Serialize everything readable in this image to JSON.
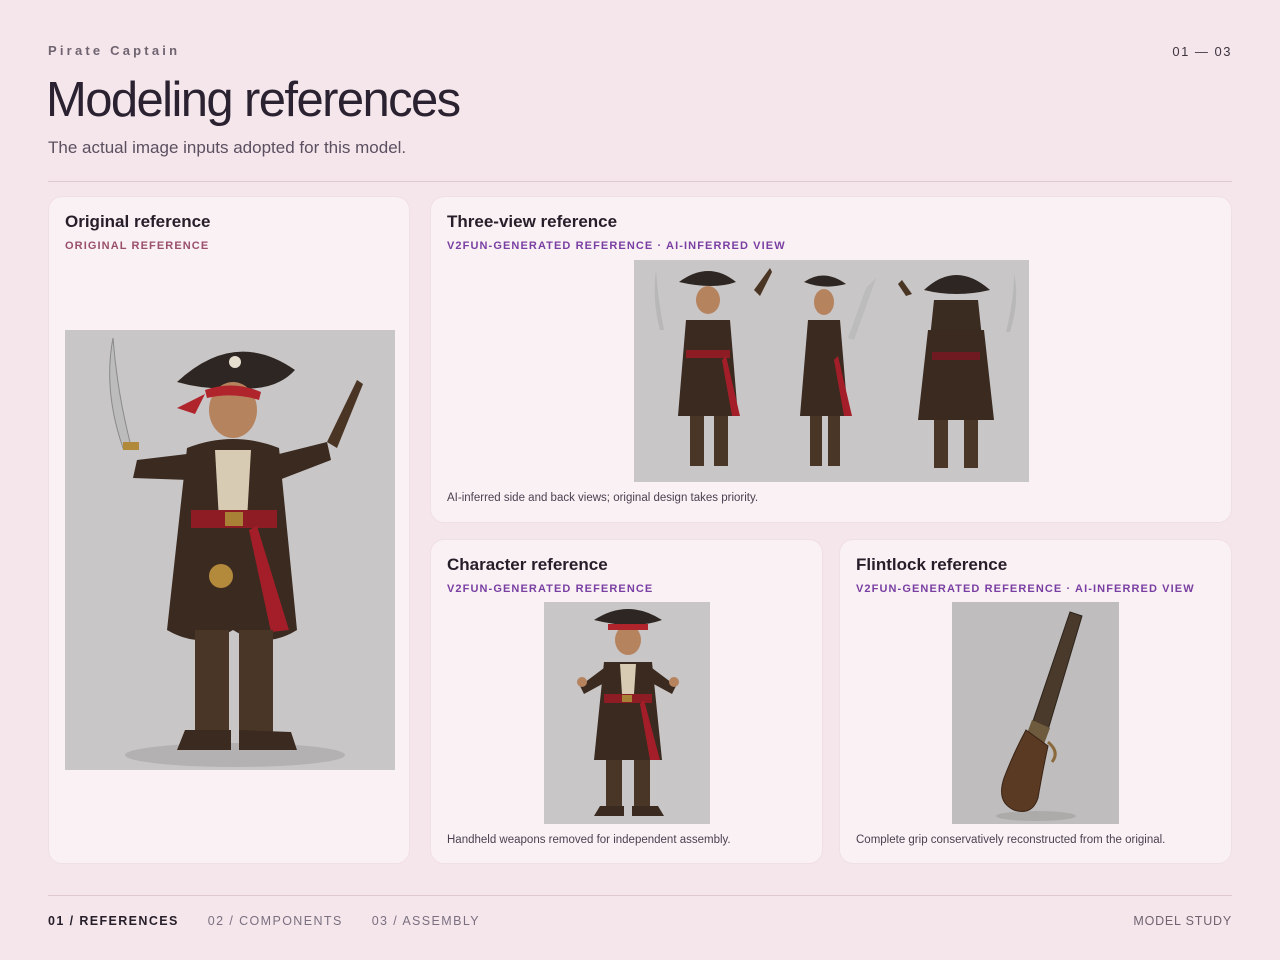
{
  "header": {
    "eyebrow": "Pirate Captain",
    "pager": "01 — 03",
    "title": "Modeling references",
    "subtitle": "The actual image inputs adopted for this model."
  },
  "cards": {
    "original": {
      "title": "Original reference",
      "tag": "ORIGINAL REFERENCE"
    },
    "three_view": {
      "title": "Three-view reference",
      "tag": "V2FUN-GENERATED REFERENCE · AI-INFERRED VIEW",
      "note": "AI-inferred side and back views; original design takes priority."
    },
    "character": {
      "title": "Character reference",
      "tag": "V2FUN-GENERATED REFERENCE",
      "note": "Handheld weapons removed for independent assembly."
    },
    "flintlock": {
      "title": "Flintlock reference",
      "tag": "V2FUN-GENERATED REFERENCE · AI-INFERRED VIEW",
      "note": "Complete grip conservatively reconstructed from the original."
    }
  },
  "footer": {
    "nav": [
      "01 / REFERENCES",
      "02 / COMPONENTS",
      "03 / ASSEMBLY"
    ],
    "active_index": 0,
    "right": "MODEL STUDY"
  },
  "colors": {
    "background": "#f5e6eb",
    "card": "#f9f1f4",
    "tag_rose": "#9a4f6a",
    "tag_purple": "#7a3fa2",
    "image_backdrop": "#c6c4c5"
  }
}
